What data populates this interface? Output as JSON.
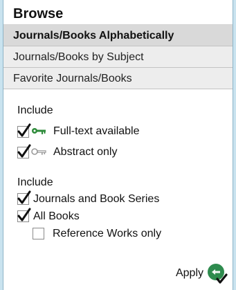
{
  "browse": {
    "title": "Browse",
    "tabs": [
      {
        "label": "Journals/Books Alphabetically",
        "active": true
      },
      {
        "label": "Journals/Books by Subject",
        "active": false
      },
      {
        "label": "Favorite Journals/Books",
        "active": false
      }
    ]
  },
  "access_filter": {
    "label": "Include",
    "options": [
      {
        "label": "Full-text available",
        "checked": true,
        "icon": "green-key-icon"
      },
      {
        "label": "Abstract only",
        "checked": true,
        "icon": "gray-key-icon"
      }
    ]
  },
  "content_filter": {
    "label": "Include",
    "options": [
      {
        "label": "Journals and Book Series",
        "checked": true
      },
      {
        "label": "All Books",
        "checked": true
      },
      {
        "label": "Reference Works only",
        "checked": false
      }
    ]
  },
  "apply": {
    "label": "Apply",
    "icon": "green-circle-check-icon"
  },
  "colors": {
    "background": "#c9e3ef",
    "active_tab": "#d9d9d9",
    "inactive_tab": "#ededed",
    "full_text_key": "#2e8b3a",
    "abstract_key": "#9a9a9a",
    "apply_icon": "#2e8b4e"
  }
}
